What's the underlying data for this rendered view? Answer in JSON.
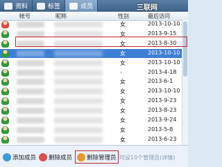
{
  "tabs": [
    {
      "label": "资料"
    },
    {
      "label": "标签"
    },
    {
      "label": "成员"
    }
  ],
  "watermark": "三联网 3LIAN.COM",
  "columns": {
    "account": "帐号",
    "nickname": "昵称",
    "sex": "性别",
    "last_visit": "最后访问"
  },
  "rows": [
    {
      "sex": "女",
      "date": "2013-10-10",
      "avatar_color": "#e04a3a"
    },
    {
      "sex": "女",
      "date": "2013-9-15",
      "avatar_color": "#2f9a36"
    },
    {
      "sex": "女",
      "date": "2013-8-30",
      "avatar_color": "#2f9a36"
    },
    {
      "sex": "女",
      "date": "2013-10-10",
      "avatar_color": "#2f9a36",
      "selected": true
    },
    {
      "sex": "女",
      "date": "2013-10-10",
      "avatar_color": "#2f9a36"
    },
    {
      "sex": "-",
      "date": "2013-4-18",
      "avatar_color": "#2f9a36"
    },
    {
      "sex": "女",
      "date": "2013-6-1",
      "avatar_color": "#2f9a36"
    },
    {
      "sex": "女",
      "date": "2013-10-10",
      "avatar_color": "#2f9a36"
    },
    {
      "sex": "女",
      "date": "2013-9-23",
      "avatar_color": "#2f9a36"
    },
    {
      "sex": "女",
      "date": "2013-8-23",
      "avatar_color": "#2f9a36"
    },
    {
      "sex": "女",
      "date": "2013-9-24",
      "avatar_color": "#2f9a36"
    },
    {
      "sex": "女",
      "date": "2013-5-8",
      "avatar_color": "#2f9a36"
    },
    {
      "sex": "女",
      "date": "2013-6-23",
      "avatar_color": "#2f9a36"
    }
  ],
  "buttons": {
    "add_member": "添加成员",
    "remove_member": "删除成员",
    "remove_admin": "删除管理员"
  },
  "hint": "可设10个管理员(详情)",
  "colors": {
    "selected_row": "#3d7fd3",
    "highlight_box": "#c4232a"
  }
}
